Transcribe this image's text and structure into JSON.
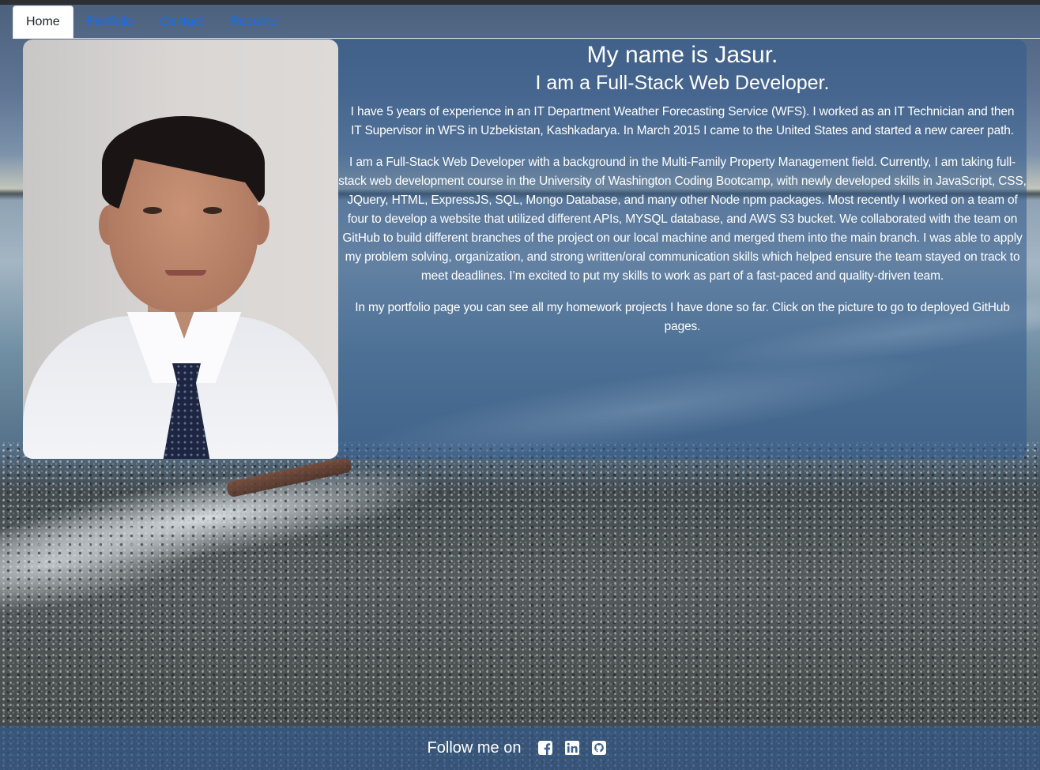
{
  "nav": {
    "tabs": [
      {
        "label": "Home",
        "active": true
      },
      {
        "label": "Portfolio",
        "active": false
      },
      {
        "label": "Contact",
        "active": false
      },
      {
        "label": "Resume",
        "active": false
      }
    ]
  },
  "main": {
    "photo_icon": "profile-photo",
    "heading": "My name is Jasur.",
    "subheading": "I am a Full-Stack Web Developer.",
    "paragraphs": [
      "I have 5 years of experience in an IT Department Weather Forecasting Service (WFS). I worked as an IT Technician and then IT Supervisor in WFS in Uzbekistan, Kashkadarya. In March 2015 I came to the United States and started a new career path.",
      "I am a Full-Stack Web Developer with a background in the Multi-Family Property Management field. Currently, I am taking full-stack web development course in the University of Washington Coding Bootcamp, with newly developed skills in JavaScript, CSS, JQuery, HTML, ExpressJS, SQL, Mongo Database, and many other Node npm packages. Most recently I worked on a team of four to develop a website that utilized different APIs, MYSQL database, and AWS S3 bucket. We collaborated with the team on GitHub to build different branches of the project on our local machine and merged them into the main branch. I was able to apply my problem solving, organization, and strong written/oral communication skills which helped ensure the team stayed on track to meet deadlines. I’m excited to put my skills to work as part of a fast-paced and quality-driven team.",
      "In my portfolio page you can see all my homework projects I have done so far. Click on the picture to go to deployed GitHub pages."
    ]
  },
  "footer": {
    "text": "Follow me on",
    "icons": [
      "facebook-icon",
      "linkedin-icon",
      "github-icon"
    ]
  },
  "colors": {
    "nav_link": "#0d6efd",
    "card_overlay": "#345c8c",
    "text": "#ffffff"
  }
}
